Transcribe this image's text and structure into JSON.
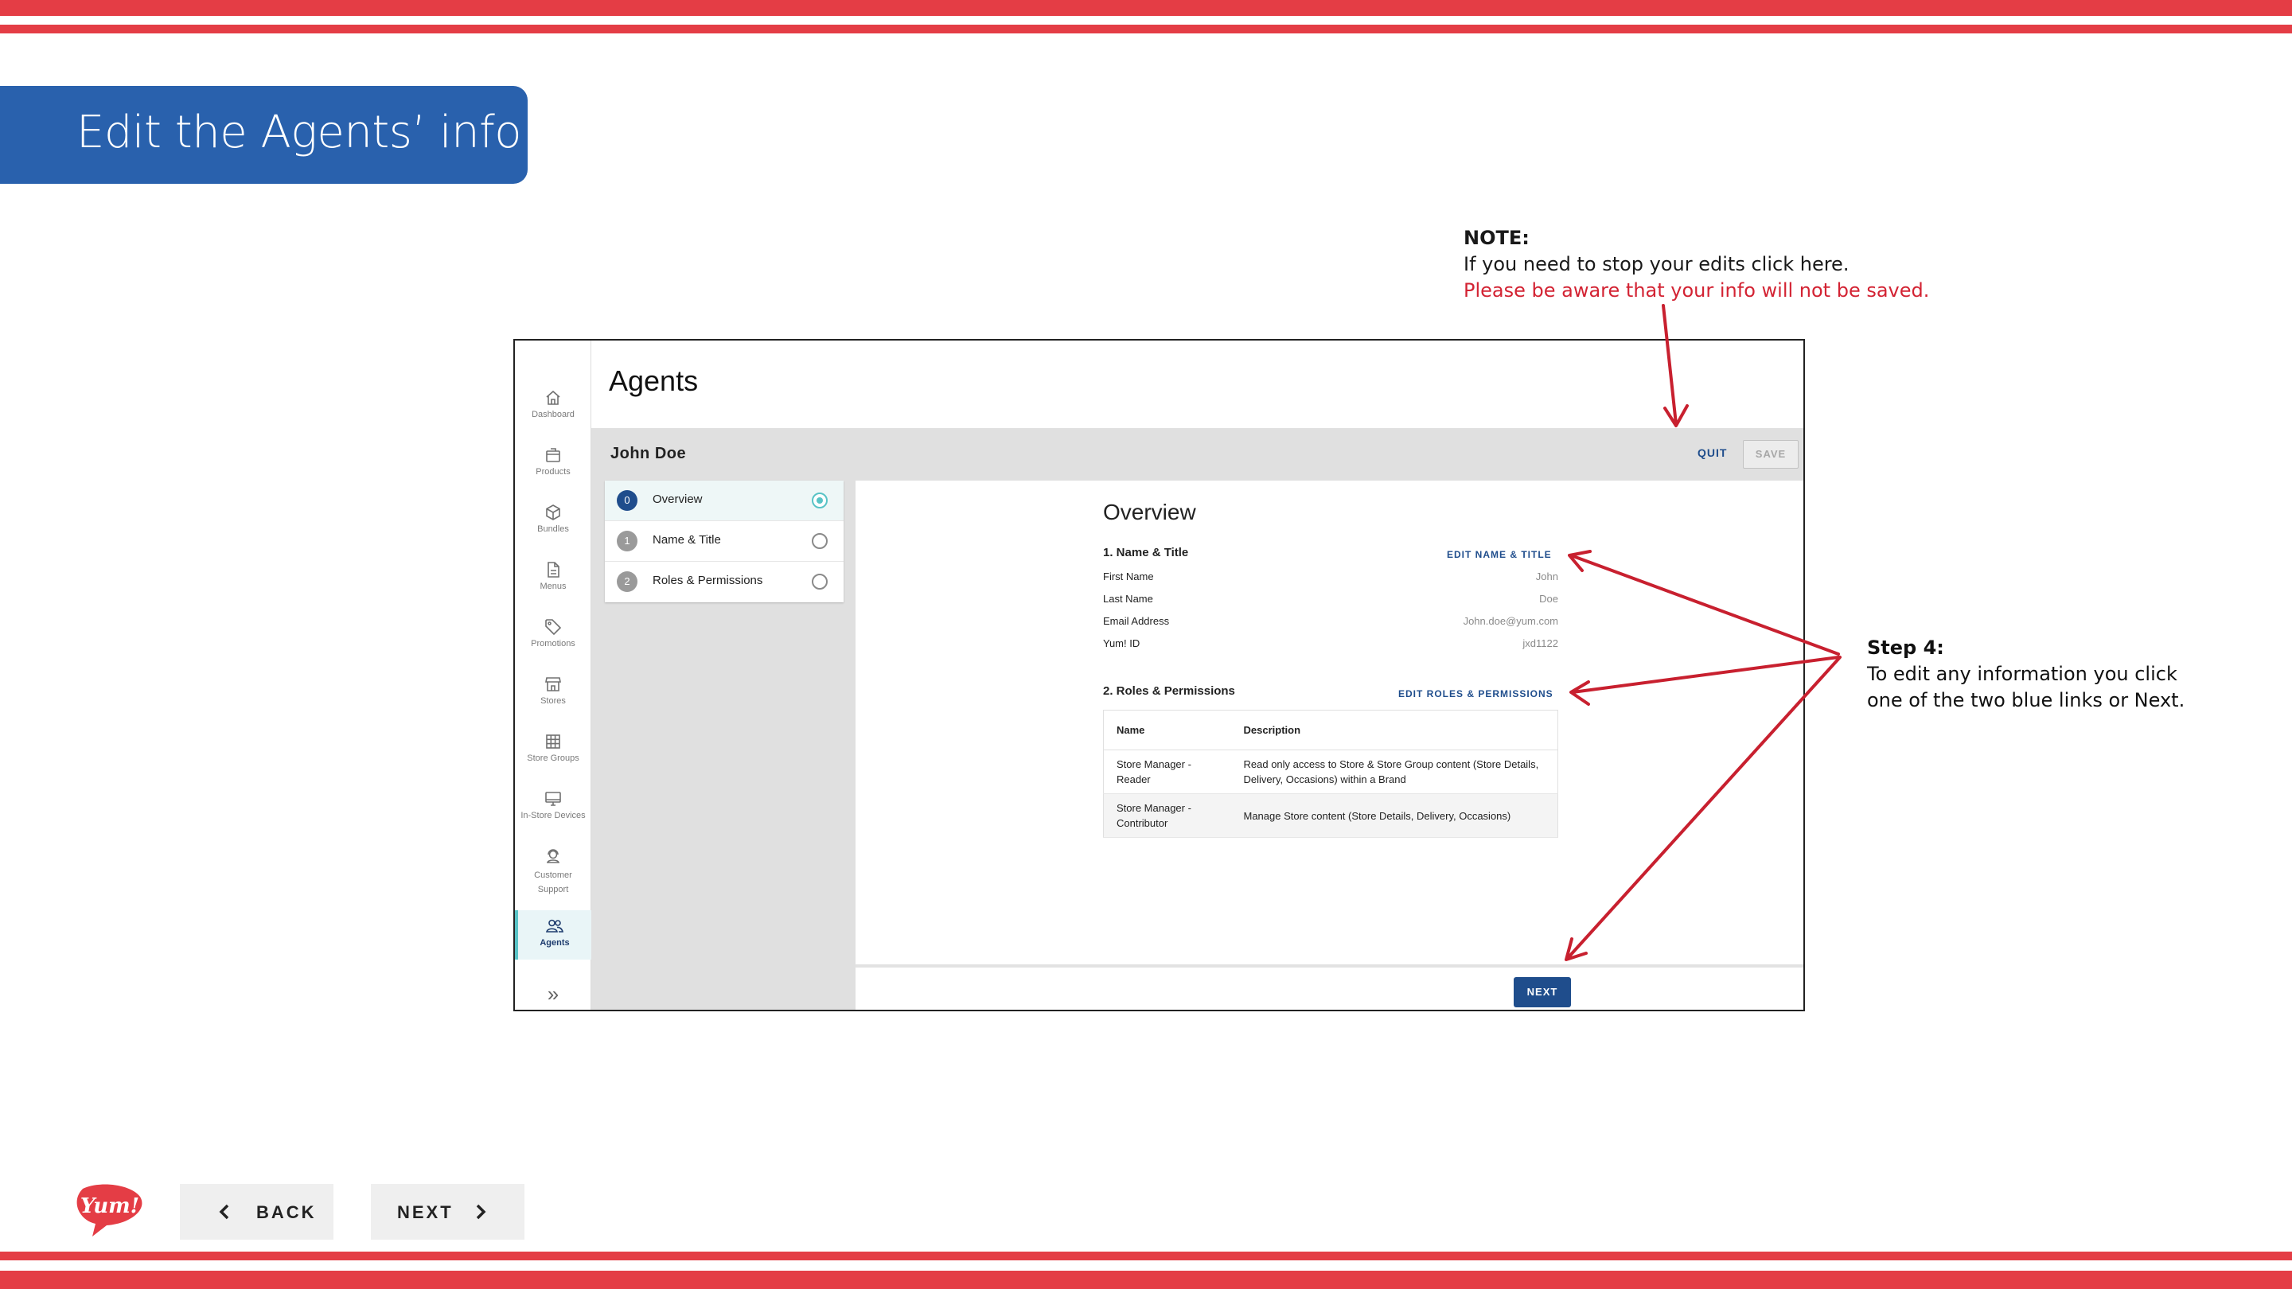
{
  "slide": {
    "title": "Edit the Agents’ info",
    "note": {
      "heading": "NOTE:",
      "line1": "If you need to stop your edits click here.",
      "line2": "Please be aware that your info will not be saved."
    },
    "step4": {
      "heading": "Step 4:",
      "line1": "To edit any information you click",
      "line2": "one of the two blue links or Next."
    },
    "back_label": "BACK",
    "next_label": "NEXT",
    "logo_text": "Yum!"
  },
  "colors": {
    "stripe_red": "#e43d45",
    "banner_blue": "#2961ad",
    "warning_red": "#d32333",
    "link_blue": "#1f4d8c",
    "active_teal": "#58c3c6",
    "arrow_red": "#c8202f"
  },
  "app": {
    "page_title": "Agents",
    "agent_name": "John Doe",
    "quit_label": "QUIT",
    "save_label": "SAVE",
    "sidebar": [
      {
        "label": "Dashboard",
        "icon": "home-icon"
      },
      {
        "label": "Products",
        "icon": "box-icon"
      },
      {
        "label": "Bundles",
        "icon": "cube-icon"
      },
      {
        "label": "Menus",
        "icon": "document-icon"
      },
      {
        "label": "Promotions",
        "icon": "tag-icon"
      },
      {
        "label": "Stores",
        "icon": "store-icon"
      },
      {
        "label": "Store Groups",
        "icon": "grid-icon"
      },
      {
        "label": "In-Store Devices",
        "icon": "monitor-icon"
      },
      {
        "label": "Customer Support",
        "icon": "headset-icon"
      },
      {
        "label": "Agents",
        "icon": "people-icon",
        "active": true
      }
    ],
    "expand_icon": "double-chevron-right-icon",
    "steps": [
      {
        "num": "0",
        "label": "Overview",
        "active": true
      },
      {
        "num": "1",
        "label": "Name & Title",
        "active": false
      },
      {
        "num": "2",
        "label": "Roles & Permissions",
        "active": false
      }
    ],
    "overview": {
      "title": "Overview",
      "name_section": {
        "title": "1. Name & Title",
        "edit_label": "EDIT NAME & TITLE",
        "fields": [
          {
            "label": "First Name",
            "value": "John"
          },
          {
            "label": "Last Name",
            "value": "Doe"
          },
          {
            "label": "Email Address",
            "value": "John.doe@yum.com"
          },
          {
            "label": "Yum! ID",
            "value": "jxd1122"
          }
        ]
      },
      "roles_section": {
        "title": "2. Roles & Permissions",
        "edit_label": "EDIT ROLES & PERMISSIONS",
        "columns": [
          "Name",
          "Description"
        ],
        "rows": [
          {
            "name": "Store Manager - Reader",
            "description": "Read only access to Store & Store Group content (Store Details, Delivery, Occasions) within a Brand"
          },
          {
            "name": "Store Manager - Contributor",
            "description": "Manage Store content (Store Details, Delivery, Occasions)"
          }
        ]
      }
    },
    "next_label": "NEXT"
  }
}
